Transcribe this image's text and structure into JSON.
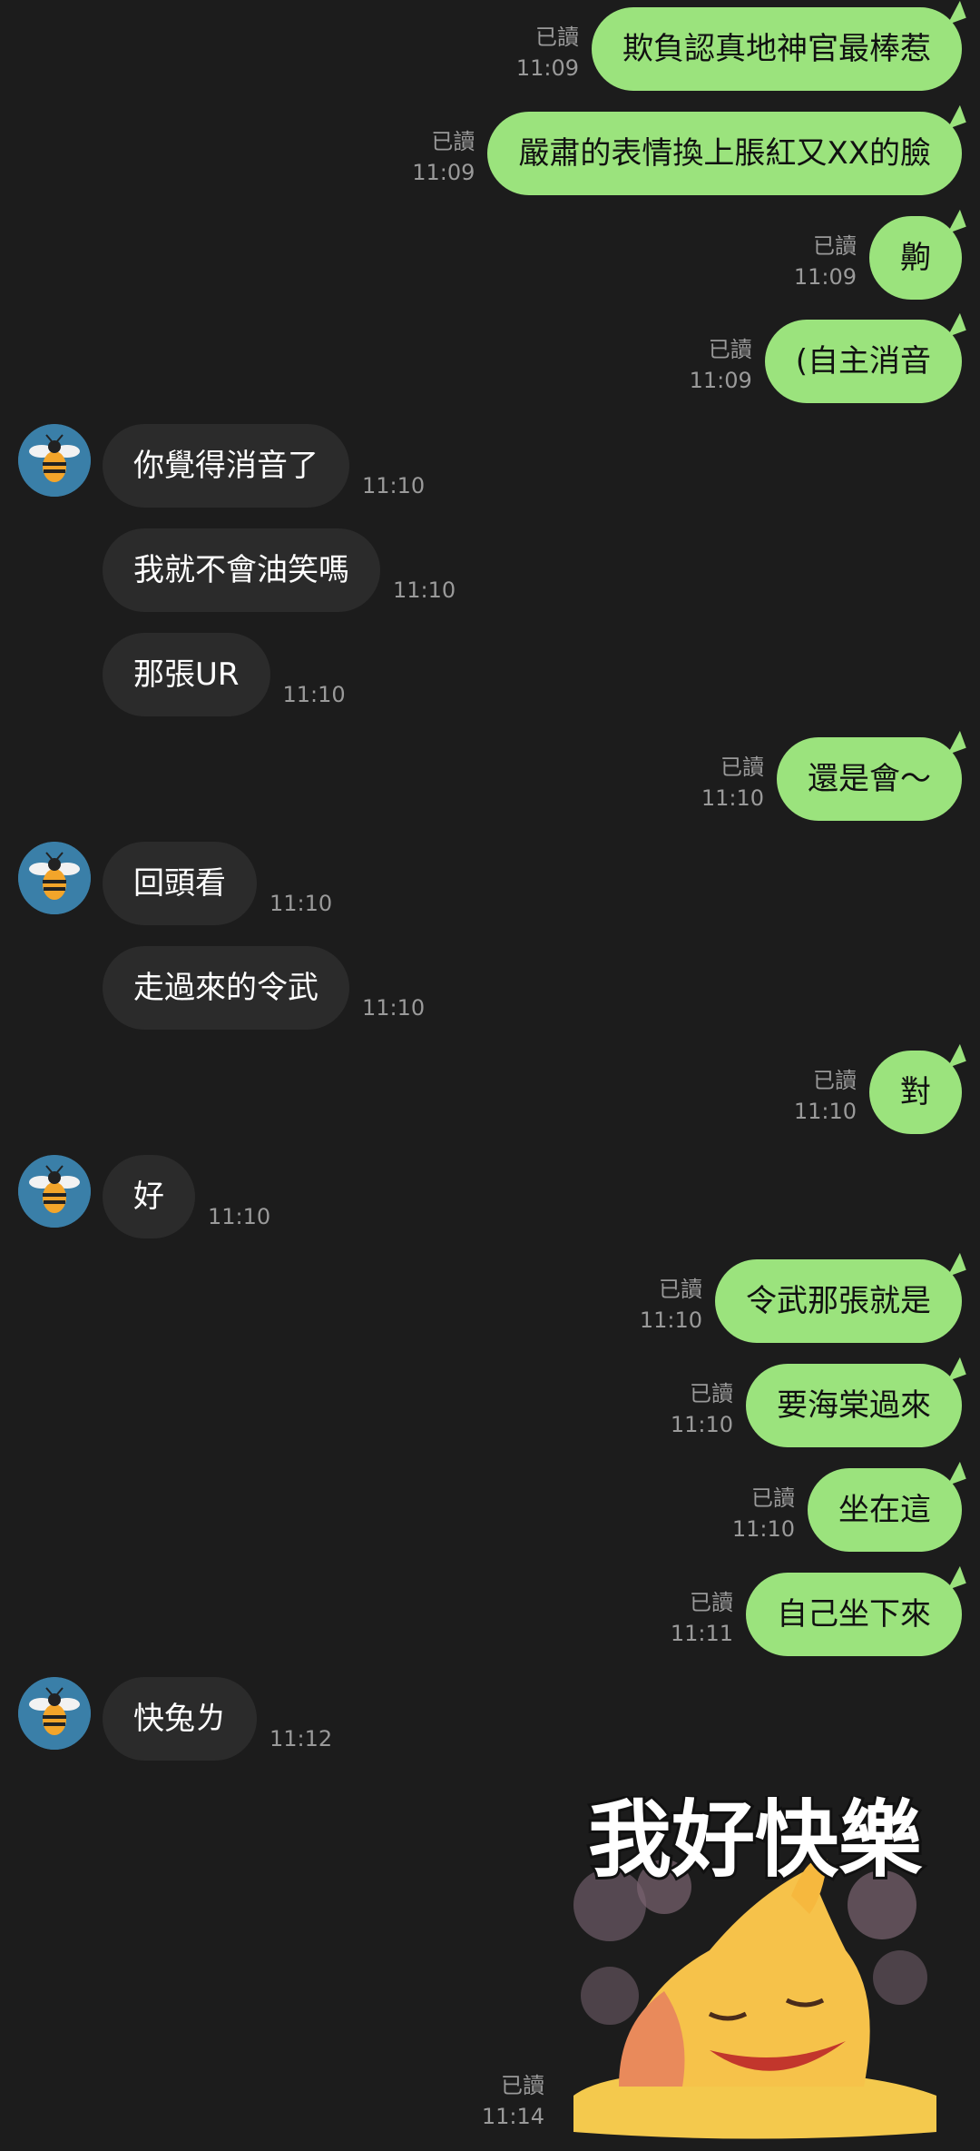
{
  "messages": [
    {
      "dir": "out",
      "text": "欺負認真地神官最棒惹",
      "status": "已讀",
      "time": "11:09"
    },
    {
      "dir": "out",
      "text": "嚴肅的表情換上脹紅又XX的臉",
      "status": "已讀",
      "time": "11:09"
    },
    {
      "dir": "out",
      "text": "齁",
      "status": "已讀",
      "time": "11:09"
    },
    {
      "dir": "out",
      "text": "(自主消音",
      "status": "已讀",
      "time": "11:09"
    },
    {
      "dir": "in",
      "text": "你覺得消音了",
      "time": "11:10",
      "avatar": true
    },
    {
      "dir": "in",
      "text": "我就不會油笑嗎",
      "time": "11:10"
    },
    {
      "dir": "in",
      "text": "那張UR",
      "time": "11:10"
    },
    {
      "dir": "out",
      "text": "還是會～",
      "status": "已讀",
      "time": "11:10"
    },
    {
      "dir": "in",
      "text": "回頭看",
      "time": "11:10",
      "avatar": true
    },
    {
      "dir": "in",
      "text": "走過來的令武",
      "time": "11:10"
    },
    {
      "dir": "out",
      "text": "對",
      "status": "已讀",
      "time": "11:10"
    },
    {
      "dir": "in",
      "text": "好",
      "time": "11:10",
      "avatar": true
    },
    {
      "dir": "out",
      "text": "令武那張就是",
      "status": "已讀",
      "time": "11:10"
    },
    {
      "dir": "out",
      "text": "要海棠過來",
      "status": "已讀",
      "time": "11:10"
    },
    {
      "dir": "out",
      "text": "坐在這",
      "status": "已讀",
      "time": "11:10"
    },
    {
      "dir": "out",
      "text": "自己坐下來",
      "status": "已讀",
      "time": "11:11"
    },
    {
      "dir": "in",
      "text": "快兔ㄌ",
      "time": "11:12",
      "avatar": true
    }
  ],
  "sticker": {
    "text": "我好快樂",
    "status": "已讀",
    "time": "11:14",
    "icon": "happy-cat-sticker"
  },
  "colors": {
    "background": "#1c1c1c",
    "out_bubble": "#9be37d",
    "in_bubble": "#2b2b2b",
    "avatar_bg": "#3a7fa8"
  }
}
